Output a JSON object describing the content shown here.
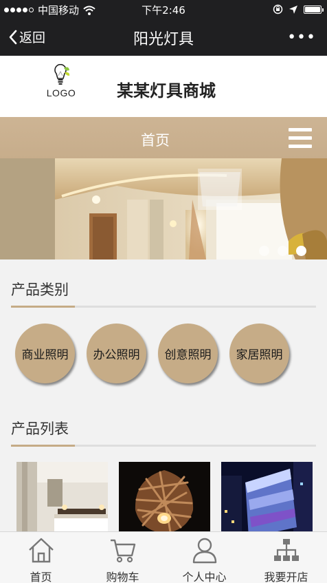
{
  "status_bar": {
    "carrier": "中国移动",
    "time": "下午2:46",
    "icons": [
      "signal-dots-icon",
      "wifi-icon",
      "orientation-lock-icon",
      "location-arrow-icon",
      "battery-icon"
    ]
  },
  "nav_bar": {
    "back_label": "返回",
    "title": "阳光灯具",
    "more_label": "•••"
  },
  "header": {
    "logo_text": "LOGO",
    "shop_name": "某某灯具商城"
  },
  "menu_bar": {
    "home_label": "首页",
    "menu_icon": "hamburger-menu-icon"
  },
  "banner": {
    "slide_count": 3,
    "active_slide": 3
  },
  "categories": {
    "title": "产品类别",
    "items": [
      "商业照明",
      "办公照明",
      "创意照明",
      "家居照明"
    ]
  },
  "products": {
    "title": "产品列表",
    "items": [
      "bedroom-lighting-image",
      "woven-pendant-lamp-image",
      "building-facade-lighting-image"
    ]
  },
  "tab_bar": {
    "tabs": [
      {
        "label": "首页",
        "icon": "home-icon"
      },
      {
        "label": "购物车",
        "icon": "cart-icon"
      },
      {
        "label": "个人中心",
        "icon": "user-icon"
      },
      {
        "label": "我要开店",
        "icon": "sitemap-icon"
      }
    ]
  },
  "colors": {
    "accent": "#c6ac87",
    "dark_bar": "#1f1f21",
    "background": "#f2f2f2"
  }
}
